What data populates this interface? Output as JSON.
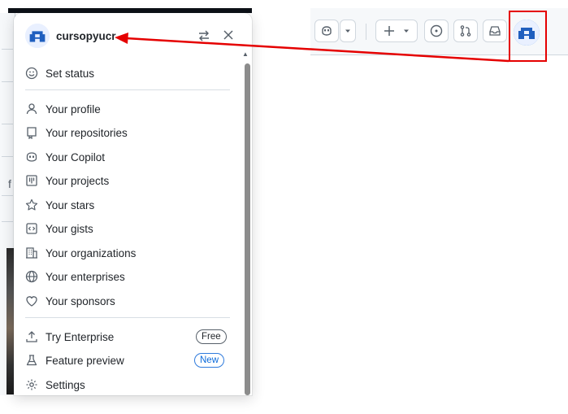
{
  "menu": {
    "username": "cursopyucr",
    "switch_icon": "arrow-switch-icon",
    "close_icon": "x-icon",
    "items": [
      {
        "label": "Set status",
        "icon": "smiley-icon"
      },
      {
        "label": "Your profile",
        "icon": "person-icon"
      },
      {
        "label": "Your repositories",
        "icon": "repo-icon"
      },
      {
        "label": "Your Copilot",
        "icon": "copilot-icon"
      },
      {
        "label": "Your projects",
        "icon": "table-icon"
      },
      {
        "label": "Your stars",
        "icon": "star-icon"
      },
      {
        "label": "Your gists",
        "icon": "code-square-icon"
      },
      {
        "label": "Your organizations",
        "icon": "organization-icon"
      },
      {
        "label": "Your enterprises",
        "icon": "globe-icon"
      },
      {
        "label": "Your sponsors",
        "icon": "heart-icon"
      },
      {
        "label": "Try Enterprise",
        "icon": "upload-icon",
        "badge": "Free"
      },
      {
        "label": "Feature preview",
        "icon": "beaker-icon",
        "badge": "New"
      },
      {
        "label": "Settings",
        "icon": "gear-icon"
      }
    ]
  },
  "header": {
    "buttons": [
      "copilot-icon",
      "triangle-down-icon",
      "plus-icon",
      "issue-opened-icon",
      "git-pull-request-icon",
      "inbox-icon"
    ],
    "avatar": "user-avatar"
  },
  "background": {
    "letter": "f"
  },
  "colors": {
    "highlight": "#e50000",
    "accent": "#0969da"
  }
}
